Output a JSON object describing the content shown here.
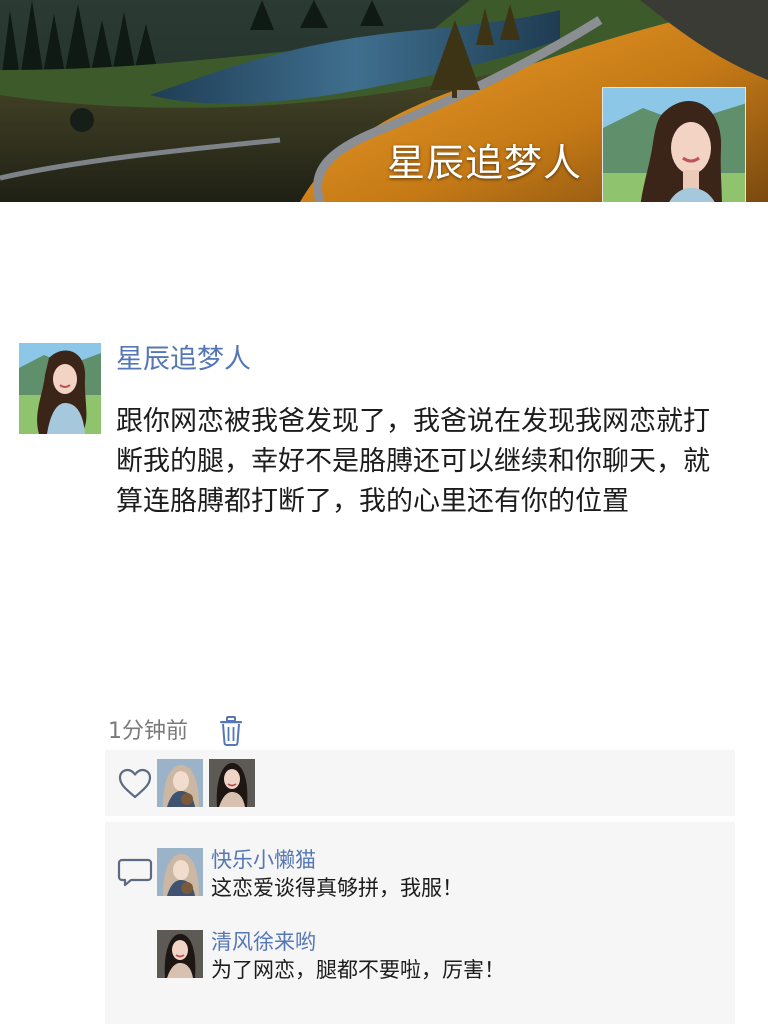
{
  "profile": {
    "name": "星辰追梦人",
    "cover_image": "mountain-lake-landscape",
    "avatar_image": "woman-portrait"
  },
  "post": {
    "author": "星辰追梦人",
    "text": "跟你网恋被我爸发现了，我爸说在发现我网恋就打断我的腿，幸好不是胳膊还可以继续和你聊天，就算连胳膊都打断了，我的心里还有你的位置",
    "time": "1分钟前",
    "delete_icon": "trash-icon"
  },
  "likes": {
    "icon": "heart-icon",
    "users": [
      {
        "avatar": "anime-girl-avatar"
      },
      {
        "avatar": "woman-portrait-avatar"
      }
    ]
  },
  "comments": {
    "icon": "comment-icon",
    "items": [
      {
        "name": "快乐小懒猫",
        "text": "这恋爱谈得真够拼，我服！",
        "avatar": "anime-girl-avatar"
      },
      {
        "name": "清风徐来哟",
        "text": "为了网恋，腿都不要啦，厉害！",
        "avatar": "woman-portrait-avatar"
      }
    ]
  },
  "colors": {
    "link": "#5677b5",
    "text": "#1c1c1c",
    "muted": "#7a7a7a",
    "panel": "#f6f6f7"
  }
}
